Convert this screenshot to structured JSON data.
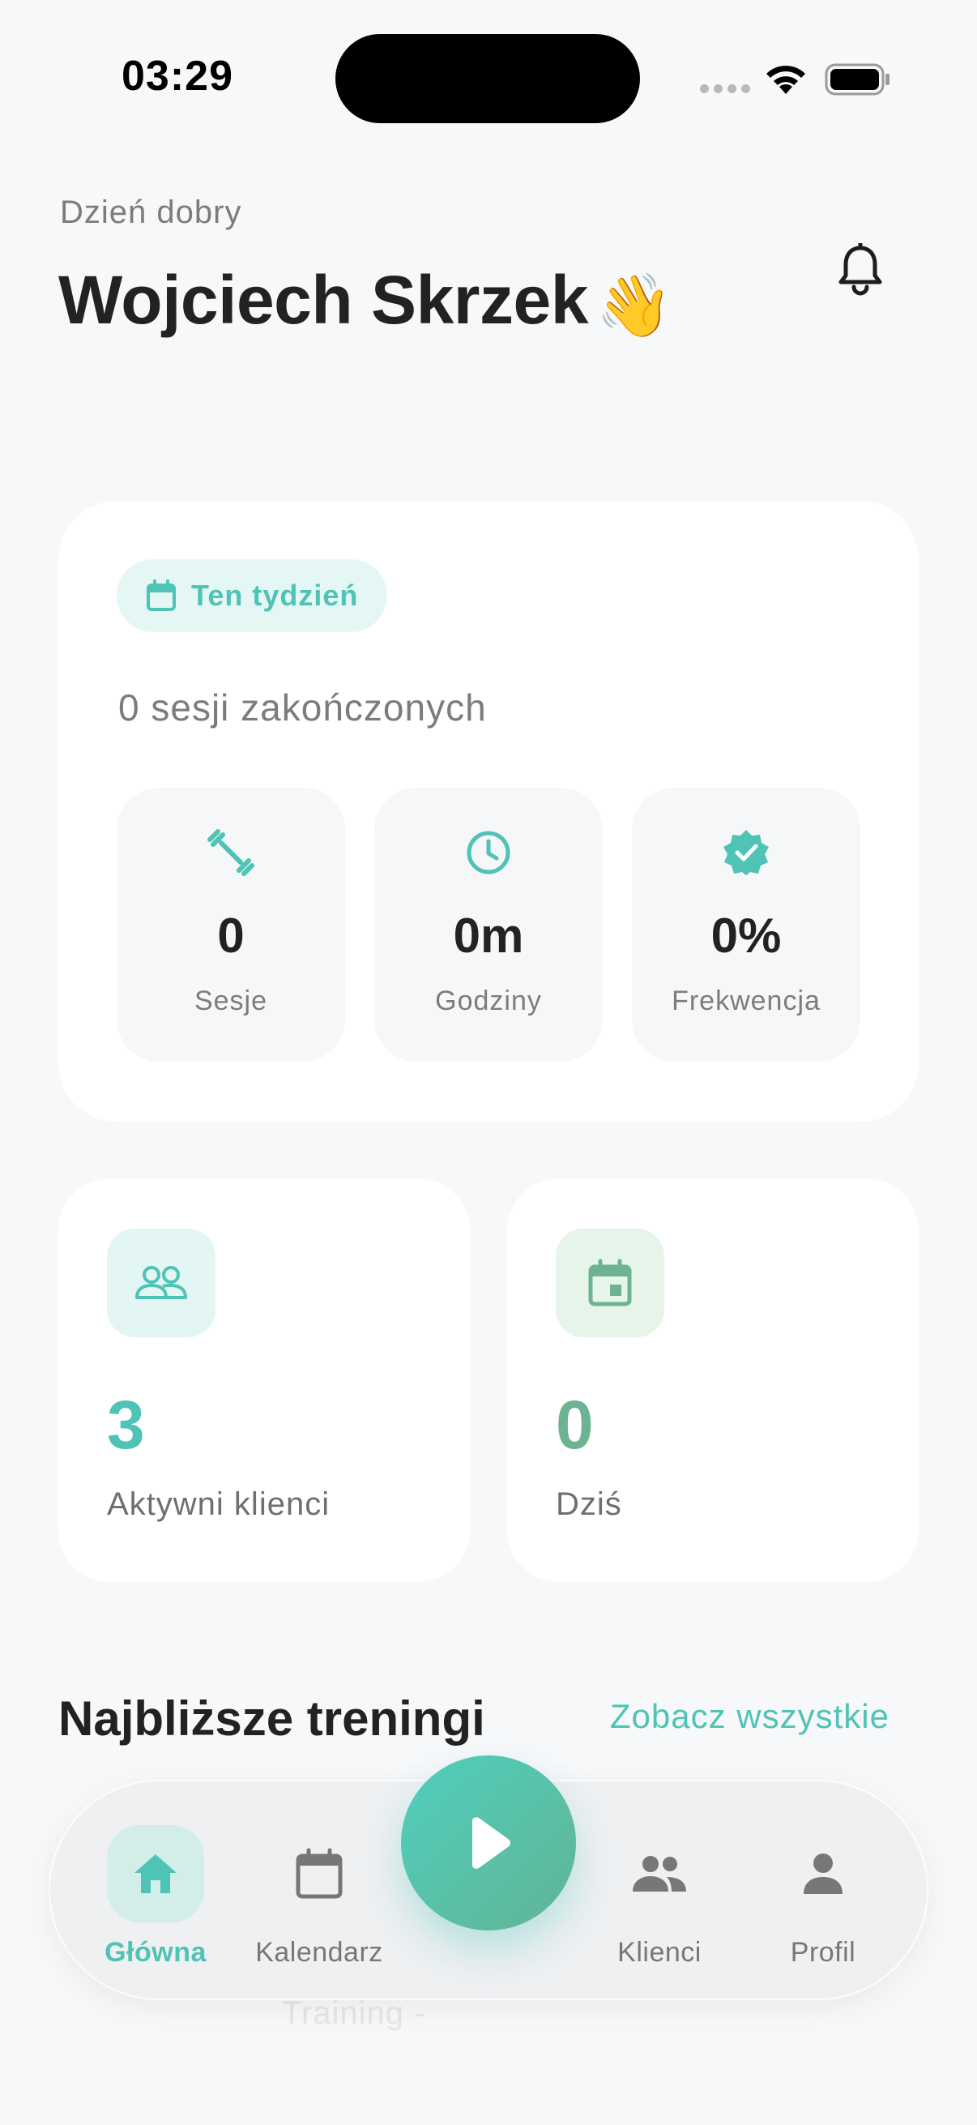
{
  "status_bar": {
    "time": "03:29"
  },
  "header": {
    "greeting": "Dzień dobry",
    "user_name": "Wojciech Skrzek",
    "wave_emoji": "👋",
    "bell_icon": "bell-icon"
  },
  "week_card": {
    "chip_label": "Ten tydzień",
    "chip_icon": "calendar-icon",
    "summary": "0 sesji zakończonych",
    "stats": [
      {
        "icon": "dumbbell-icon",
        "value": "0",
        "label": "Sesje"
      },
      {
        "icon": "clock-icon",
        "value": "0m",
        "label": "Godziny"
      },
      {
        "icon": "verified-badge-icon",
        "value": "0%",
        "label": "Frekwencja"
      }
    ]
  },
  "summary_cards": [
    {
      "icon": "clients-group-icon",
      "value": "3",
      "label": "Aktywni klienci",
      "accent": "#4ec3b6",
      "icon_bg": "#e3f6f3"
    },
    {
      "icon": "calendar-today-icon",
      "value": "0",
      "label": "Dziś",
      "accent": "#6db393",
      "icon_bg": "#e6f4ea"
    }
  ],
  "upcoming": {
    "title": "Najbliższe treningi",
    "see_all": "Zobacz wszystkie",
    "peek_text": "Training -"
  },
  "tab_bar": {
    "items": [
      {
        "label": "Główna",
        "icon": "home-icon",
        "active": true
      },
      {
        "label": "Kalendarz",
        "icon": "calendar-icon",
        "active": false
      },
      {
        "label": "Klienci",
        "icon": "clients-icon",
        "active": false
      },
      {
        "label": "Profil",
        "icon": "profile-icon",
        "active": false
      }
    ],
    "center_action_icon": "play-icon"
  },
  "colors": {
    "accent": "#4ec3b6",
    "accent_green": "#6db393",
    "background": "#f7f8fa",
    "card": "#ffffff"
  }
}
